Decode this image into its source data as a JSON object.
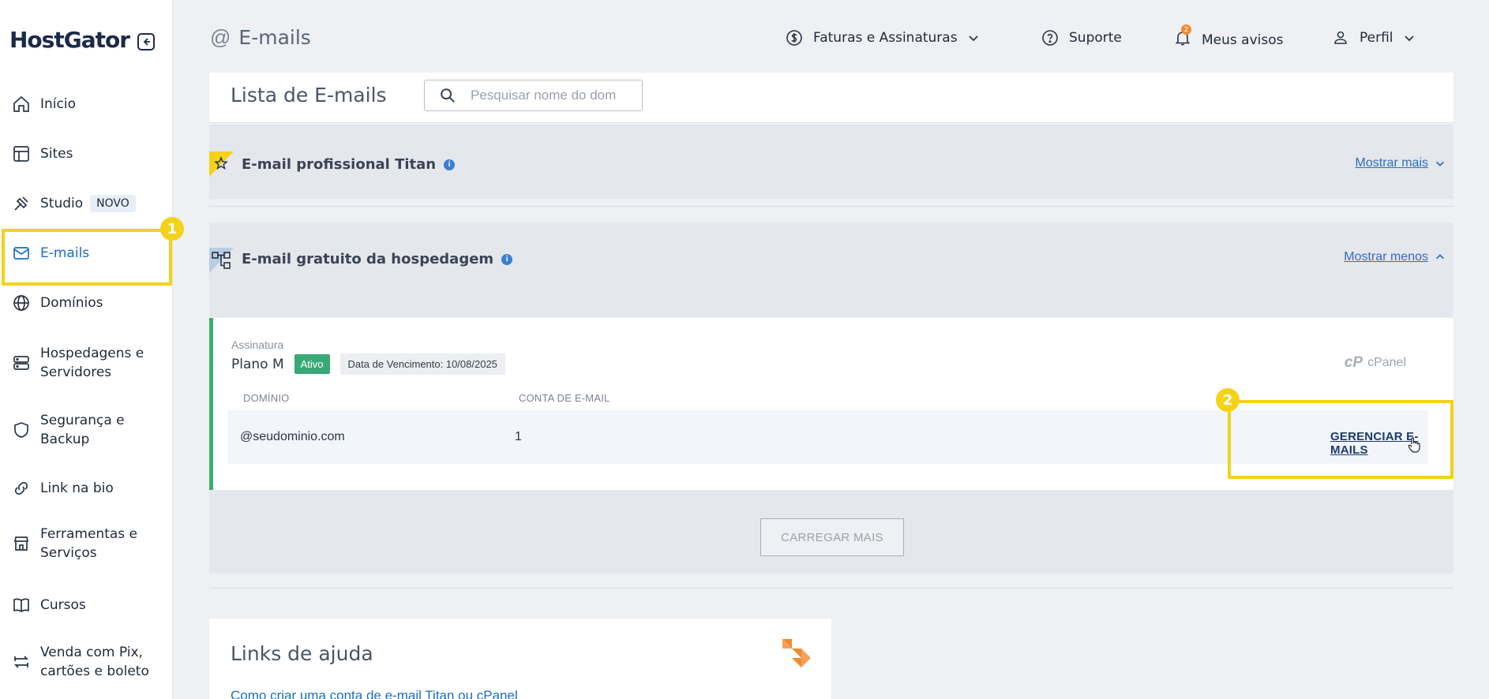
{
  "sidebar": {
    "logo": "HostGator",
    "items": [
      {
        "label": "Início",
        "icon": "home-icon"
      },
      {
        "label": "Sites",
        "icon": "layout-icon"
      },
      {
        "label": "Studio",
        "icon": "studio-tools-icon",
        "badge": "NOVO"
      },
      {
        "label": "E-mails",
        "icon": "mail-icon",
        "active": true
      },
      {
        "label": "Domínios",
        "icon": "globe-icon"
      },
      {
        "label": "Hospedagens e Servidores",
        "icon": "server-icon"
      },
      {
        "label": "Segurança e Backup",
        "icon": "shield-icon"
      },
      {
        "label": "Link na bio",
        "icon": "link-icon"
      },
      {
        "label": "Ferramentas e Serviços",
        "icon": "store-icon"
      },
      {
        "label": "Cursos",
        "icon": "book-icon"
      },
      {
        "label": "Venda com Pix, cartões e boleto",
        "icon": "transfer-icon"
      }
    ]
  },
  "callouts": {
    "one": "1",
    "two": "2"
  },
  "header": {
    "title": "E-mails",
    "title_icon": "@",
    "links": {
      "billing": "Faturas e Assinaturas",
      "support": "Suporte",
      "notices": "Meus avisos",
      "notices_count": "2",
      "profile": "Perfil"
    }
  },
  "list": {
    "title": "Lista de E-mails",
    "search_placeholder": "Pesquisar nome do dom"
  },
  "titan": {
    "title": "E-mail profissional Titan",
    "toggle": "Mostrar mais"
  },
  "free": {
    "title": "E-mail gratuito da hospedagem",
    "toggle": "Mostrar menos"
  },
  "plan": {
    "subtitle": "Assinatura",
    "name": "Plano M",
    "status": "Ativo",
    "due": "Data de Vencimento: 10/08/2025",
    "provider": "cPanel",
    "columns": {
      "domain": "DOMÍNIO",
      "account": "CONTA DE E-MAIL"
    },
    "row": {
      "domain": "@seudominio.com",
      "accounts": "1",
      "action": "GERENCIAR E-MAILS"
    }
  },
  "load_more": "CARREGAR MAIS",
  "help": {
    "title": "Links de ajuda",
    "link": "Como criar uma conta de e-mail Titan ou cPanel"
  },
  "colors": {
    "accent": "#1b6ec2",
    "highlight": "#f4d21a",
    "active_green": "#3aa876"
  }
}
